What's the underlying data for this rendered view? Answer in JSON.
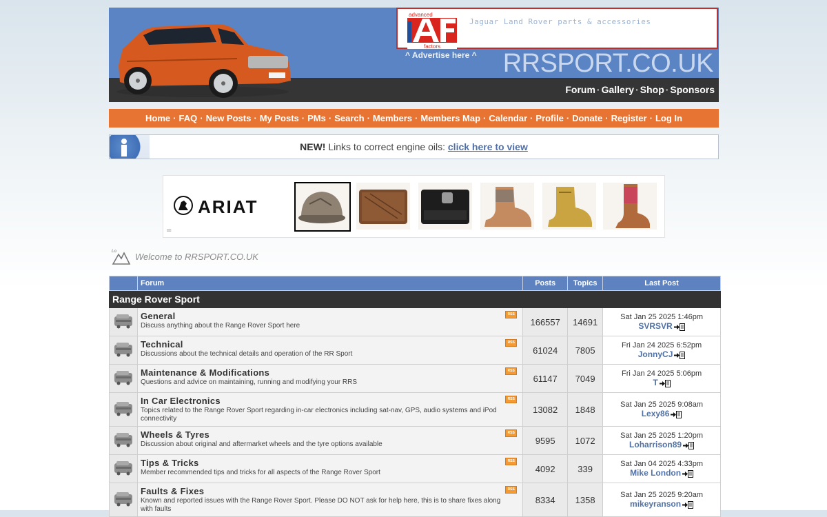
{
  "header": {
    "ad_text": "Jaguar Land Rover parts & accessories",
    "ad_logo_top": "advanced",
    "ad_logo_letters": "AF",
    "ad_logo_bottom": "factors",
    "advertise": "^ Advertise here ^",
    "site_title": "RRSPORT.CO.UK",
    "links": [
      "Forum",
      "Gallery",
      "Shop",
      "Sponsors"
    ]
  },
  "nav": [
    "Home",
    "FAQ",
    "New Posts",
    "My Posts",
    "PMs",
    "Search",
    "Members",
    "Members Map",
    "Calendar",
    "Profile",
    "Donate",
    "Register",
    "Log In"
  ],
  "notice": {
    "new": "NEW!",
    "text": "Links to correct engine oils:",
    "link": "click here to view"
  },
  "banner": {
    "brand": "ARIAT",
    "marker": "="
  },
  "welcome": "Welcome to RRSPORT.CO.UK",
  "table": {
    "headers": [
      "Forum",
      "Posts",
      "Topics",
      "Last Post"
    ],
    "category": "Range Rover Sport",
    "rows": [
      {
        "title": "General",
        "desc": "Discuss anything about the Range Rover Sport here",
        "posts": "166557",
        "topics": "14691",
        "date": "Sat Jan 25 2025 1:46pm",
        "user": "SVRSVR"
      },
      {
        "title": "Technical",
        "desc": "Discussions about the technical details and operation of the RR Sport",
        "posts": "61024",
        "topics": "7805",
        "date": "Fri Jan 24 2025 6:52pm",
        "user": "JonnyCJ"
      },
      {
        "title": "Maintenance & Modifications",
        "desc": "Questions and advice on maintaining, running and modifying your RRS",
        "posts": "61147",
        "topics": "7049",
        "date": "Fri Jan 24 2025 5:06pm",
        "user": "T"
      },
      {
        "title": "In Car Electronics",
        "desc": "Topics related to the Range Rover Sport regarding in-car electronics including sat-nav, GPS, audio systems and iPod connectivity",
        "posts": "13082",
        "topics": "1848",
        "date": "Sat Jan 25 2025 9:08am",
        "user": "Lexy86"
      },
      {
        "title": "Wheels & Tyres",
        "desc": "Discussion about original and aftermarket wheels and the tyre options available",
        "posts": "9595",
        "topics": "1072",
        "date": "Sat Jan 25 2025 1:20pm",
        "user": "Loharrison89"
      },
      {
        "title": "Tips & Tricks",
        "desc": "Member recommended tips and tricks for all aspects of the Range Rover Sport",
        "posts": "4092",
        "topics": "339",
        "date": "Sat Jan 04 2025 4:33pm",
        "user": "Mike London"
      },
      {
        "title": "Faults & Fixes",
        "desc": "Known and reported issues with the Range Rover Sport. Please DO NOT ask for help here, this is to share fixes along with faults",
        "posts": "8334",
        "topics": "1358",
        "date": "Sat Jan 25 2025 9:20am",
        "user": "mikeyranson"
      }
    ]
  },
  "colors": {
    "header_blue": "#5a84c3",
    "nav_orange": "#e87433",
    "table_header": "#5e82c0",
    "category_bar": "#333333",
    "user_link": "#5071a6"
  }
}
